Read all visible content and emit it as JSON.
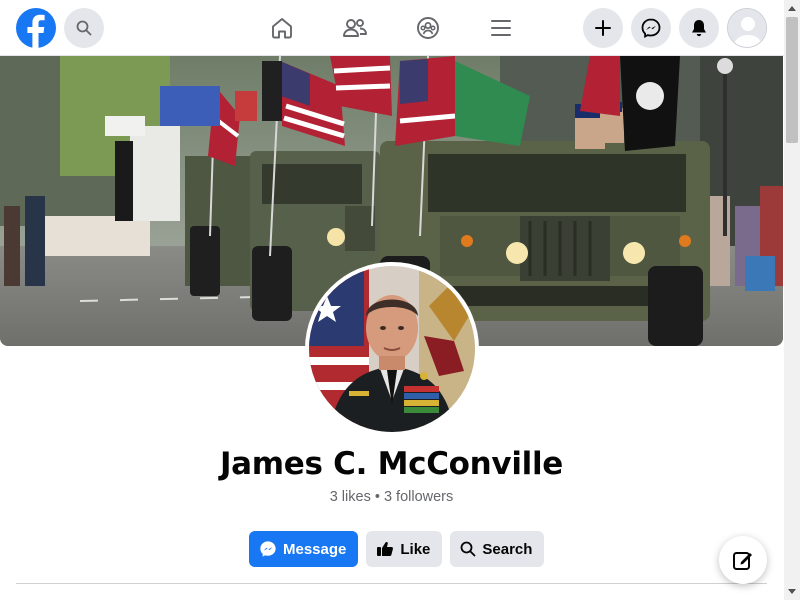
{
  "nav": {
    "logo": "facebook-logo",
    "search_icon": "search-icon",
    "center_icons": [
      "home-icon",
      "friends-icon",
      "groups-icon",
      "menu-icon"
    ],
    "right_icons": [
      "plus-icon",
      "messenger-icon",
      "bell-icon"
    ],
    "avatar": "default-avatar"
  },
  "profile": {
    "name": "James C. McConville",
    "stats": "3 likes • 3 followers"
  },
  "actions": {
    "message_label": "Message",
    "like_label": "Like",
    "search_label": "Search"
  },
  "colors": {
    "brand": "#1877f2",
    "button_secondary": "#e4e6eb",
    "text_primary": "#050505",
    "text_secondary": "#65676b"
  }
}
